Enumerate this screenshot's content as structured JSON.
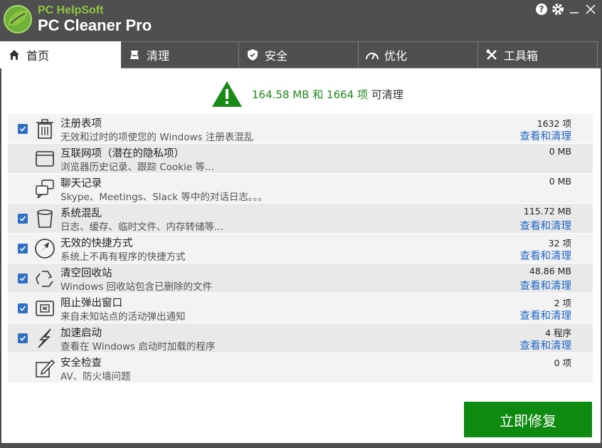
{
  "app": {
    "brand_sub": "PC HelpSoft",
    "brand_main": "PC Cleaner Pro"
  },
  "tabs": [
    {
      "label": "首页",
      "icon": "home-icon"
    },
    {
      "label": "清理",
      "icon": "broom-icon"
    },
    {
      "label": "安全",
      "icon": "shield-icon"
    },
    {
      "label": "优化",
      "icon": "speedometer-icon"
    },
    {
      "label": "工具箱",
      "icon": "tools-icon"
    }
  ],
  "summary": {
    "amount": "164.58 MB 和 1664 项",
    "suffix": "可清理"
  },
  "items": [
    {
      "title": "注册表项",
      "desc": "无效和过时的项使您的 Windows 注册表混乱",
      "value": "1632  项",
      "link": "查看和清理",
      "checked": true,
      "icon": "trash-can-icon"
    },
    {
      "title": "互联网项（潜在的隐私项）",
      "desc": "浏览器历史记录、跟踪 Cookie 等...",
      "value": "0  MB",
      "link": "",
      "checked": false,
      "icon": "browser-window-icon"
    },
    {
      "title": "聊天记录",
      "desc": "Skype、Meetings、Slack 等中的对话日志。。。",
      "value": "0  MB",
      "link": "",
      "checked": false,
      "icon": "chat-bubbles-icon"
    },
    {
      "title": "系统混乱",
      "desc": "日志、缓存、临时文件、内存转储等...",
      "value": "115.72  MB",
      "link": "查看和清理",
      "checked": true,
      "icon": "bin-icon"
    },
    {
      "title": "无效的快捷方式",
      "desc": "系统上不再有程序的快捷方式",
      "value": "32  项",
      "link": "查看和清理",
      "checked": true,
      "icon": "broken-shortcut-icon"
    },
    {
      "title": "清空回收站",
      "desc": "Windows 回收站包含已删除的文件",
      "value": "48.86  MB",
      "link": "查看和清理",
      "checked": true,
      "icon": "recycle-icon"
    },
    {
      "title": "阻止弹出窗口",
      "desc": "来自未知站点的活动弹出通知",
      "value": "2  项",
      "link": "查看和清理",
      "checked": true,
      "icon": "popup-block-icon"
    },
    {
      "title": "加速启动",
      "desc": "查看在 Windows 启动时加载的程序",
      "value": "4  程序",
      "link": "查看和清理",
      "checked": true,
      "icon": "lightning-icon"
    },
    {
      "title": "安全检查",
      "desc": "AV、防火墙问题",
      "value": "0  项",
      "link": "",
      "checked": false,
      "icon": "pencil-edit-icon"
    }
  ],
  "fix_button": "立即修复",
  "colors": {
    "accent_green": "#0f8a10",
    "link_blue": "#1f66c3",
    "titlebar": "#4f4f4f"
  }
}
